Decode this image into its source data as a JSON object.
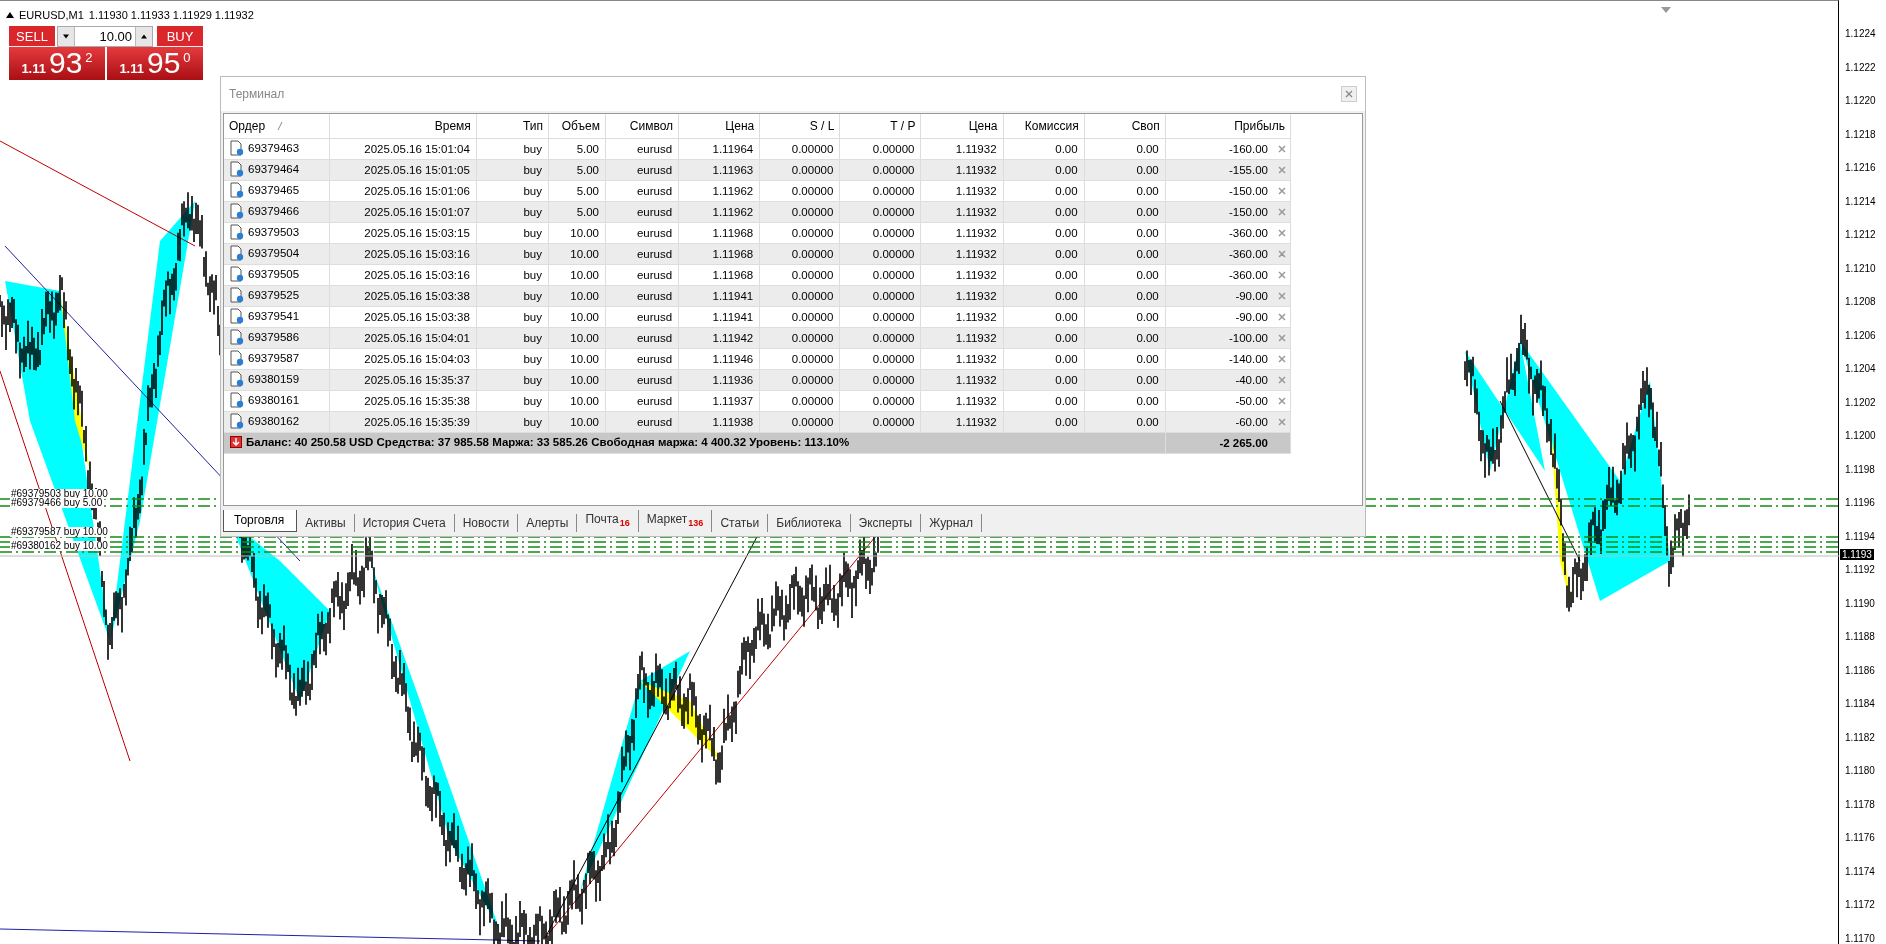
{
  "chart": {
    "symbol_title": "EURUSD,M1",
    "quote": "1.11930 1.11933 1.11929 1.11932",
    "price_axis": [
      "1.1224",
      "1.1222",
      "1.1220",
      "1.1218",
      "1.1216",
      "1.1214",
      "1.1212",
      "1.1210",
      "1.1208",
      "1.1206",
      "1.1204",
      "1.1202",
      "1.1200",
      "1.1198",
      "1.1196",
      "1.1194",
      "1.1192",
      "1.1190",
      "1.1188",
      "1.1186",
      "1.1184",
      "1.1182",
      "1.1180",
      "1.1178",
      "1.1176",
      "1.1174",
      "1.1172",
      "1.1170"
    ],
    "current_price": "1.1193",
    "order_labels": [
      "#69379503 buy 10.00",
      "#69379466 buy 5.00",
      "#69379587 buy 10.00",
      "#69380162 buy 10.00"
    ]
  },
  "trade_panel": {
    "sell_label": "SELL",
    "buy_label": "BUY",
    "lot": "10.00",
    "sell_price": {
      "prefix": "1.11",
      "big": "93",
      "small": "2"
    },
    "buy_price": {
      "prefix": "1.11",
      "big": "95",
      "small": "0"
    }
  },
  "terminal": {
    "title": "Терминал",
    "columns": [
      "Ордер",
      "Время",
      "Тип",
      "Объем",
      "Символ",
      "Цена",
      "S / L",
      "T / P",
      "Цена",
      "Комиссия",
      "Своп",
      "Прибыль"
    ],
    "rows": [
      {
        "cells": [
          "69379463",
          "2025.05.16 15:01:04",
          "buy",
          "5.00",
          "eurusd",
          "1.11964",
          "0.00000",
          "0.00000",
          "1.11932",
          "0.00",
          "0.00",
          "-160.00"
        ]
      },
      {
        "cells": [
          "69379464",
          "2025.05.16 15:01:05",
          "buy",
          "5.00",
          "eurusd",
          "1.11963",
          "0.00000",
          "0.00000",
          "1.11932",
          "0.00",
          "0.00",
          "-155.00"
        ]
      },
      {
        "cells": [
          "69379465",
          "2025.05.16 15:01:06",
          "buy",
          "5.00",
          "eurusd",
          "1.11962",
          "0.00000",
          "0.00000",
          "1.11932",
          "0.00",
          "0.00",
          "-150.00"
        ]
      },
      {
        "cells": [
          "69379466",
          "2025.05.16 15:01:07",
          "buy",
          "5.00",
          "eurusd",
          "1.11962",
          "0.00000",
          "0.00000",
          "1.11932",
          "0.00",
          "0.00",
          "-150.00"
        ]
      },
      {
        "cells": [
          "69379503",
          "2025.05.16 15:03:15",
          "buy",
          "10.00",
          "eurusd",
          "1.11968",
          "0.00000",
          "0.00000",
          "1.11932",
          "0.00",
          "0.00",
          "-360.00"
        ]
      },
      {
        "cells": [
          "69379504",
          "2025.05.16 15:03:16",
          "buy",
          "10.00",
          "eurusd",
          "1.11968",
          "0.00000",
          "0.00000",
          "1.11932",
          "0.00",
          "0.00",
          "-360.00"
        ]
      },
      {
        "cells": [
          "69379505",
          "2025.05.16 15:03:16",
          "buy",
          "10.00",
          "eurusd",
          "1.11968",
          "0.00000",
          "0.00000",
          "1.11932",
          "0.00",
          "0.00",
          "-360.00"
        ]
      },
      {
        "cells": [
          "69379525",
          "2025.05.16 15:03:38",
          "buy",
          "10.00",
          "eurusd",
          "1.11941",
          "0.00000",
          "0.00000",
          "1.11932",
          "0.00",
          "0.00",
          "-90.00"
        ]
      },
      {
        "cells": [
          "69379541",
          "2025.05.16 15:03:38",
          "buy",
          "10.00",
          "eurusd",
          "1.11941",
          "0.00000",
          "0.00000",
          "1.11932",
          "0.00",
          "0.00",
          "-90.00"
        ]
      },
      {
        "cells": [
          "69379586",
          "2025.05.16 15:04:01",
          "buy",
          "10.00",
          "eurusd",
          "1.11942",
          "0.00000",
          "0.00000",
          "1.11932",
          "0.00",
          "0.00",
          "-100.00"
        ]
      },
      {
        "cells": [
          "69379587",
          "2025.05.16 15:04:03",
          "buy",
          "10.00",
          "eurusd",
          "1.11946",
          "0.00000",
          "0.00000",
          "1.11932",
          "0.00",
          "0.00",
          "-140.00"
        ]
      },
      {
        "cells": [
          "69380159",
          "2025.05.16 15:35:37",
          "buy",
          "10.00",
          "eurusd",
          "1.11936",
          "0.00000",
          "0.00000",
          "1.11932",
          "0.00",
          "0.00",
          "-40.00"
        ]
      },
      {
        "cells": [
          "69380161",
          "2025.05.16 15:35:38",
          "buy",
          "10.00",
          "eurusd",
          "1.11937",
          "0.00000",
          "0.00000",
          "1.11932",
          "0.00",
          "0.00",
          "-50.00"
        ]
      },
      {
        "cells": [
          "69380162",
          "2025.05.16 15:35:39",
          "buy",
          "10.00",
          "eurusd",
          "1.11938",
          "0.00000",
          "0.00000",
          "1.11932",
          "0.00",
          "0.00",
          "-60.00"
        ]
      }
    ],
    "summary": {
      "text": "Баланс: 40 250.58 USD  Средства: 37 985.58  Маржа: 33 585.26  Свободная маржа: 4 400.32  Уровень: 113.10%",
      "profit": "-2 265.00"
    },
    "tabs": [
      {
        "label": "Торговля",
        "selected": true
      },
      {
        "label": "Активы",
        "selected": false
      },
      {
        "label": "История Счета",
        "selected": false
      },
      {
        "label": "Новости",
        "selected": false
      },
      {
        "label": "Алерты",
        "selected": false
      },
      {
        "label": "Почта",
        "badge": "16",
        "selected": false
      },
      {
        "label": "Маркет",
        "badge": "136",
        "selected": false
      },
      {
        "label": "Статьи",
        "selected": false
      },
      {
        "label": "Библиотека",
        "selected": false
      },
      {
        "label": "Эксперты",
        "selected": false
      },
      {
        "label": "Журнал",
        "selected": false
      }
    ]
  }
}
